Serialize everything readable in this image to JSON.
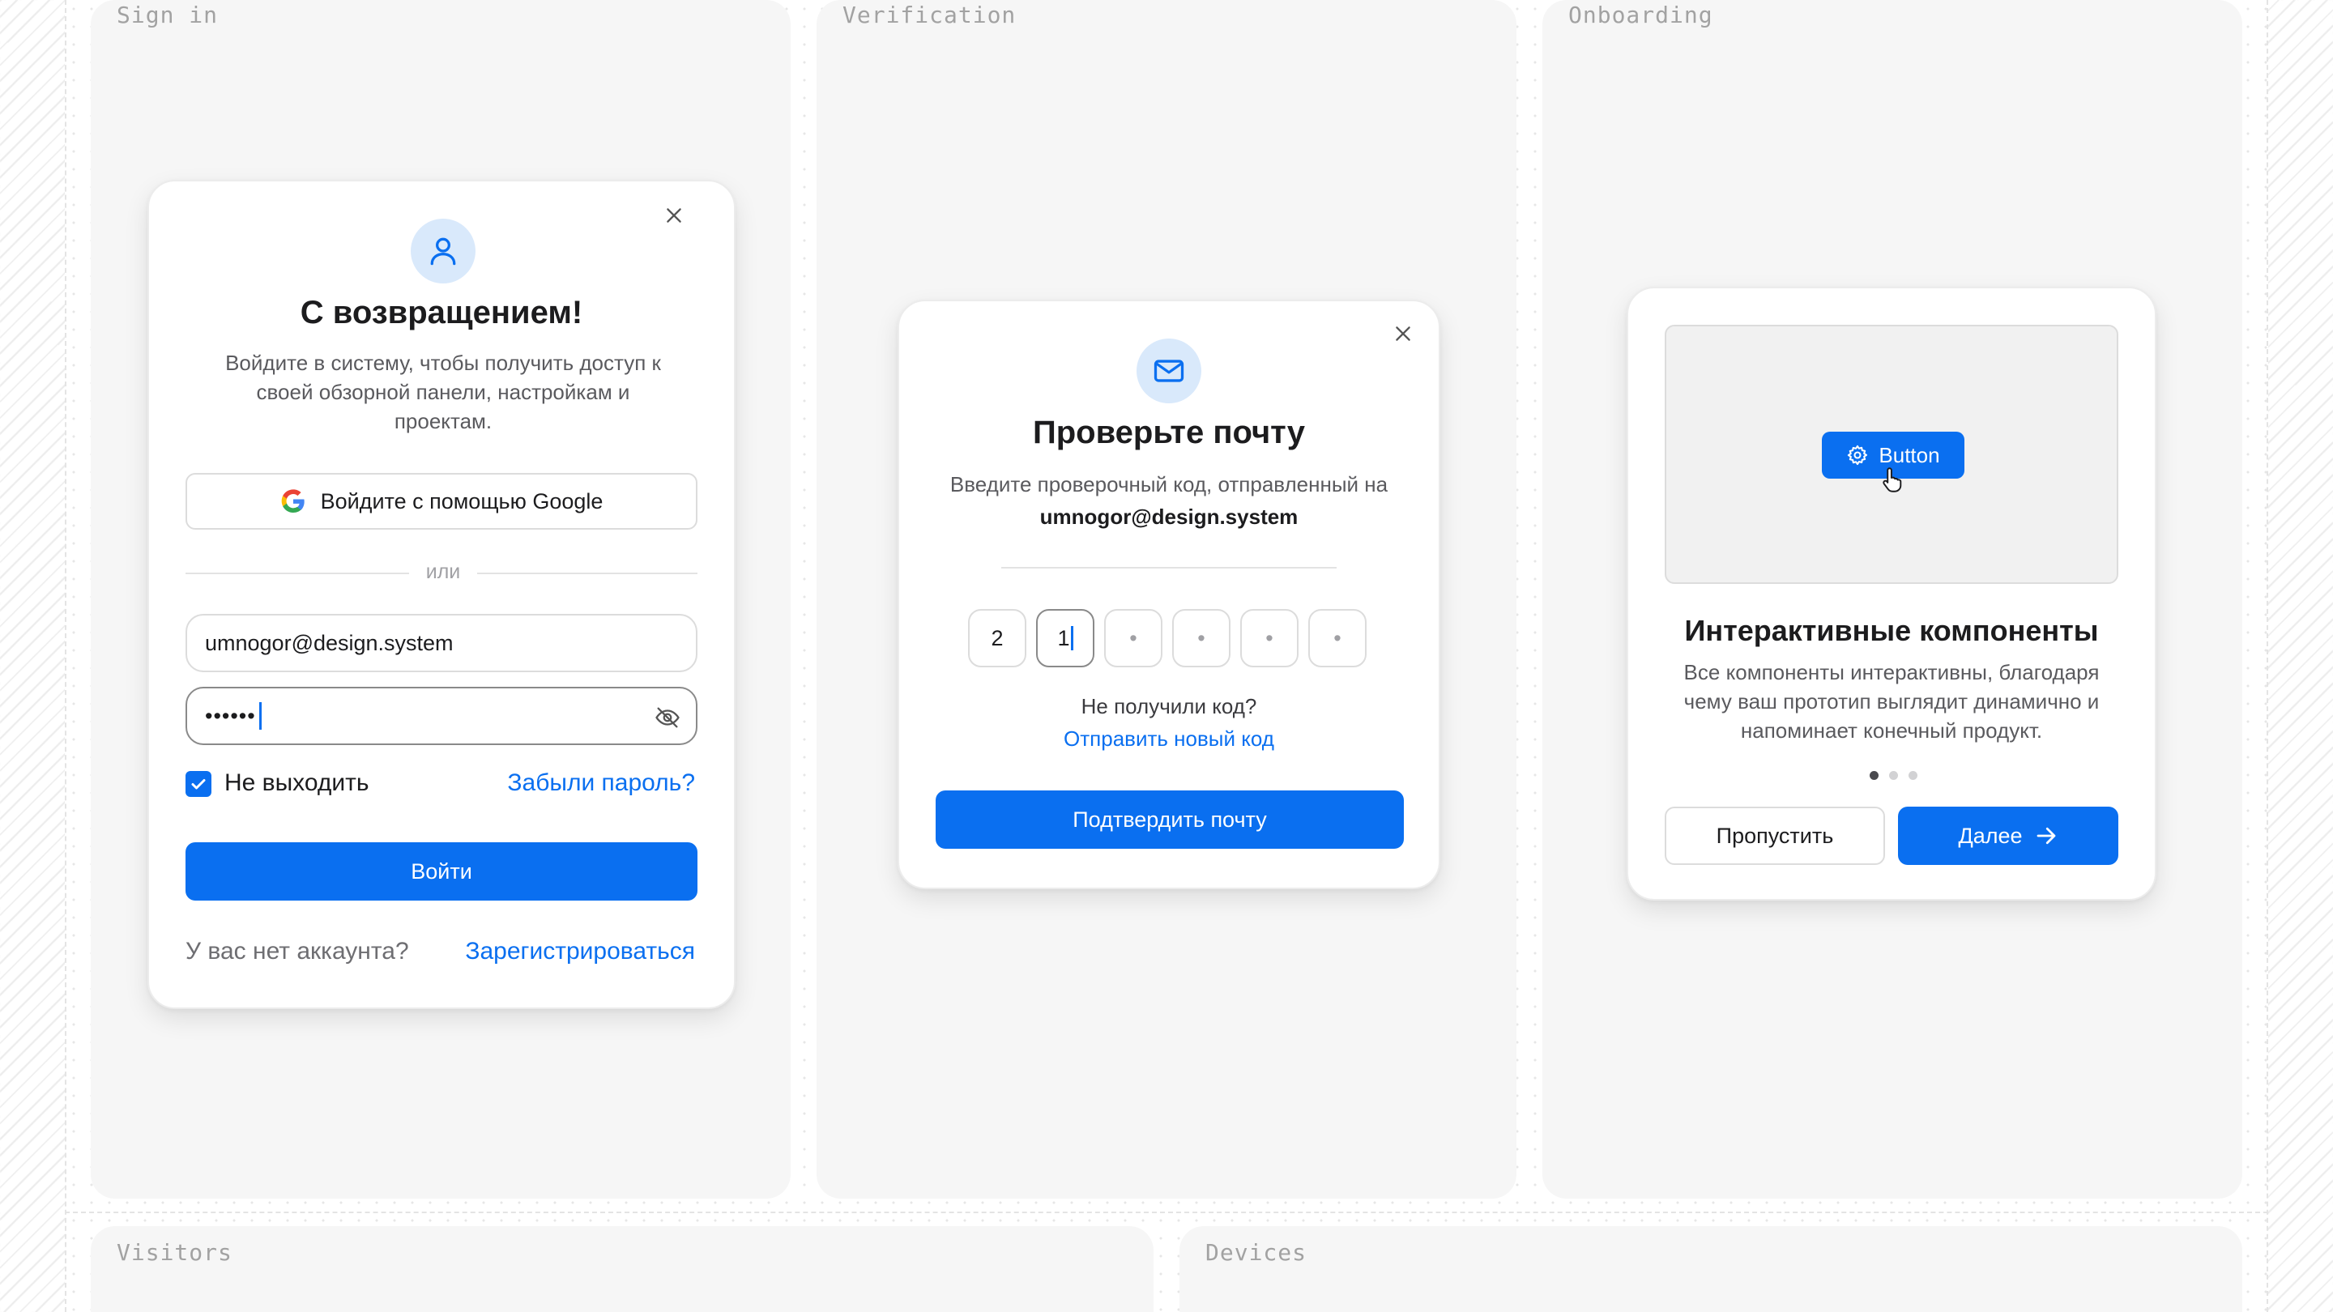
{
  "panels": {
    "signin_label": "Sign in",
    "verification_label": "Verification",
    "onboarding_label": "Onboarding",
    "visitors_label": "Visitors",
    "devices_label": "Devices"
  },
  "signin": {
    "title": "С возвращением!",
    "description": "Войдите в систему, чтобы получить доступ к своей обзорной панели, настройкам и проектам.",
    "google_button": "Войдите с помощью Google",
    "divider": "или",
    "email_value": "umnogor@design.system",
    "password_mask": "••••••",
    "remember_label": "Не выходить",
    "remember_checked": true,
    "forgot_link": "Забыли пароль?",
    "submit_button": "Войти",
    "no_account": "У вас нет аккаунта?",
    "register_link": "Зарегистрироваться"
  },
  "verification": {
    "title": "Проверьте почту",
    "description": "Введите проверочный код, отправленный на",
    "email": "umnogor@design.system",
    "otp": [
      "2",
      "1",
      "•",
      "•",
      "•",
      "•"
    ],
    "no_code": "Не получили код?",
    "resend_link": "Отправить новый код",
    "confirm_button": "Подтвердить почту"
  },
  "onboarding": {
    "demo_button": "Button",
    "title": "Интерактивные компоненты",
    "description": "Все компоненты интерактивны, благодаря чему ваш прототип выглядит динамично и напоминает конечный продукт.",
    "step_current": 1,
    "step_total": 3,
    "skip_button": "Пропустить",
    "next_button": "Далее"
  },
  "colors": {
    "accent": "#0a6ff0",
    "icon_bg": "#d9e9fb",
    "panel_bg": "#f6f6f6"
  }
}
